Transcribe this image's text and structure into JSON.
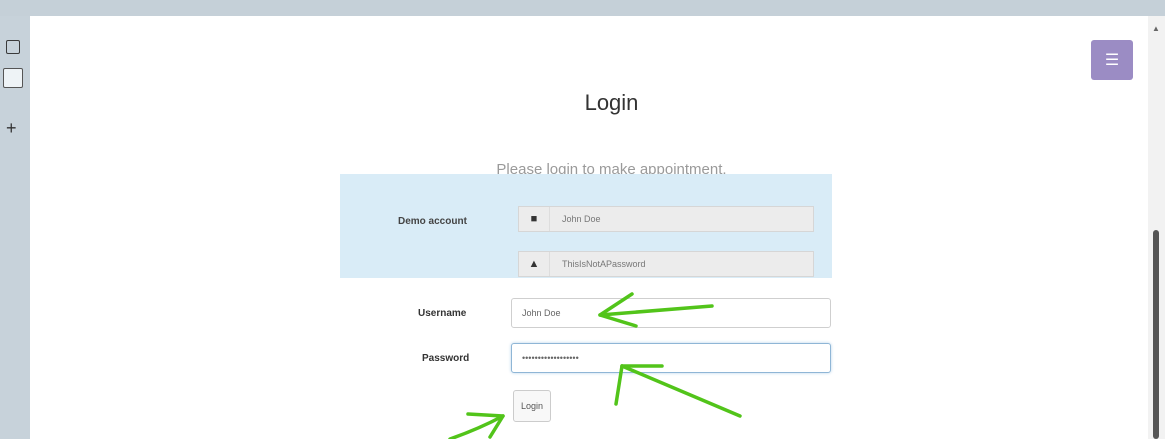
{
  "page": {
    "heading": "Login",
    "subheading": "Please login to make appointment."
  },
  "demo": {
    "label": "Demo account",
    "username": "John Doe",
    "password": "ThisIsNotAPassword"
  },
  "form": {
    "username_label": "Username",
    "username_value": "John Doe",
    "password_label": "Password",
    "password_value": "ThisIsNotAPassword",
    "login_label": "Login"
  },
  "icons": {
    "menu": "menu-icon",
    "user": "user-icon",
    "lock": "lock-icon"
  },
  "colors": {
    "menu_button": "#9b8cc4",
    "demo_box": "#d9ecf7",
    "annotation_arrows": "#52c41a"
  }
}
